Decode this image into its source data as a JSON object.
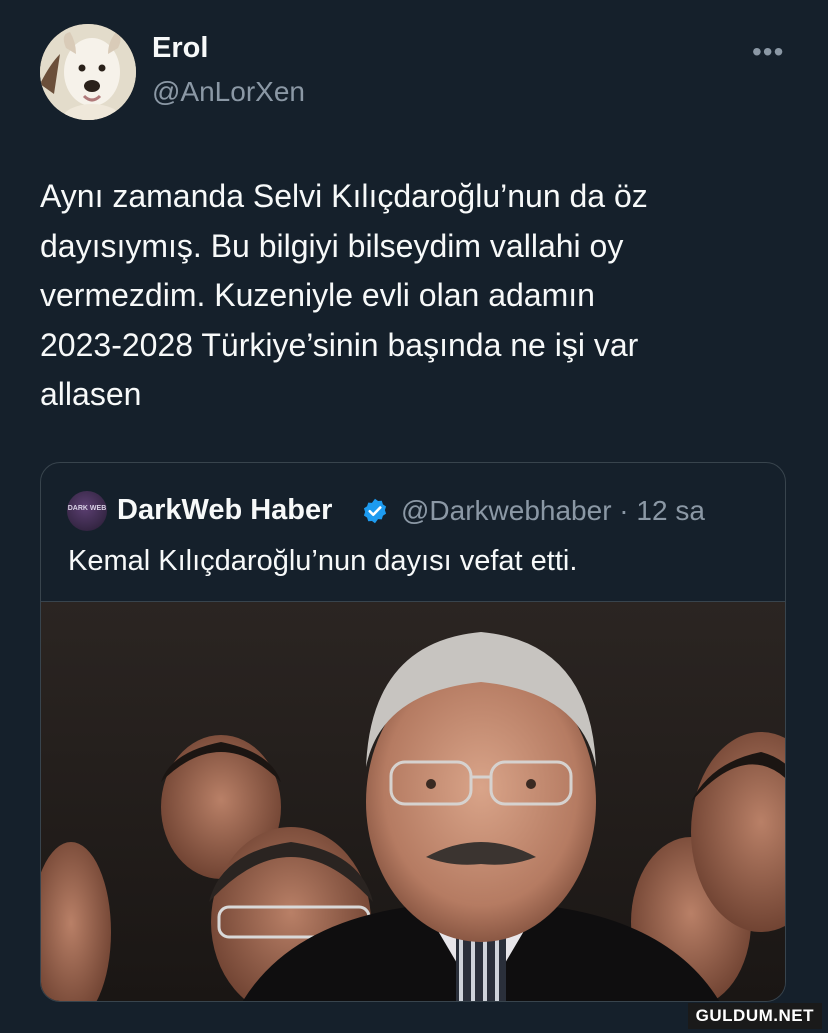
{
  "tweet": {
    "author": {
      "display_name": "Erol",
      "handle": "@AnLorXen",
      "avatar_icon": "dog-avatar-icon"
    },
    "more_label": "•••",
    "text_lines": [
      "Aynı zamanda Selvi Kılıçdaroğlu’nun da öz",
      "dayısıymış. Bu bilgiyi bilseydim vallahi oy",
      "vermezdim. Kuzeniyle evli olan adamın",
      "2023-2028 Türkiye’sinin başında ne işi var",
      "allasen"
    ]
  },
  "quoted_tweet": {
    "author": {
      "display_name": "DarkWeb Haber",
      "avatar_text": "DARK WEB",
      "verified_icon": "verified-badge-icon",
      "handle_time": "@Darkwebhaber · 12 sa"
    },
    "text": "Kemal Kılıçdaroğlu’nun dayısı vefat etti.",
    "photo_icon": "news-photo"
  },
  "watermark": "GULDUM.NET",
  "colors": {
    "background": "#15202b",
    "text_primary": "#f7f9f9",
    "text_secondary": "#8b98a5",
    "border": "#38444d",
    "verified": "#1d9bf0"
  }
}
